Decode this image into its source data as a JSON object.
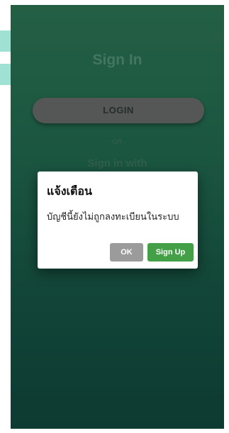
{
  "screen": {
    "title": "Sign In",
    "login_label": "LOGIN",
    "or_text": "- OR -",
    "sign_in_with": "Sign in with"
  },
  "dialog": {
    "title": "แจ้งเตือน",
    "message": "บัญชีนี้ยังไม่ถูกลงทะเบียนในระบบ",
    "ok_label": "OK",
    "signup_label": "Sign Up"
  },
  "colors": {
    "accent_green": "#43a047",
    "ok_gray": "#9b9b9b",
    "background_top": "#3a9a6f",
    "background_bottom": "#165e50"
  }
}
